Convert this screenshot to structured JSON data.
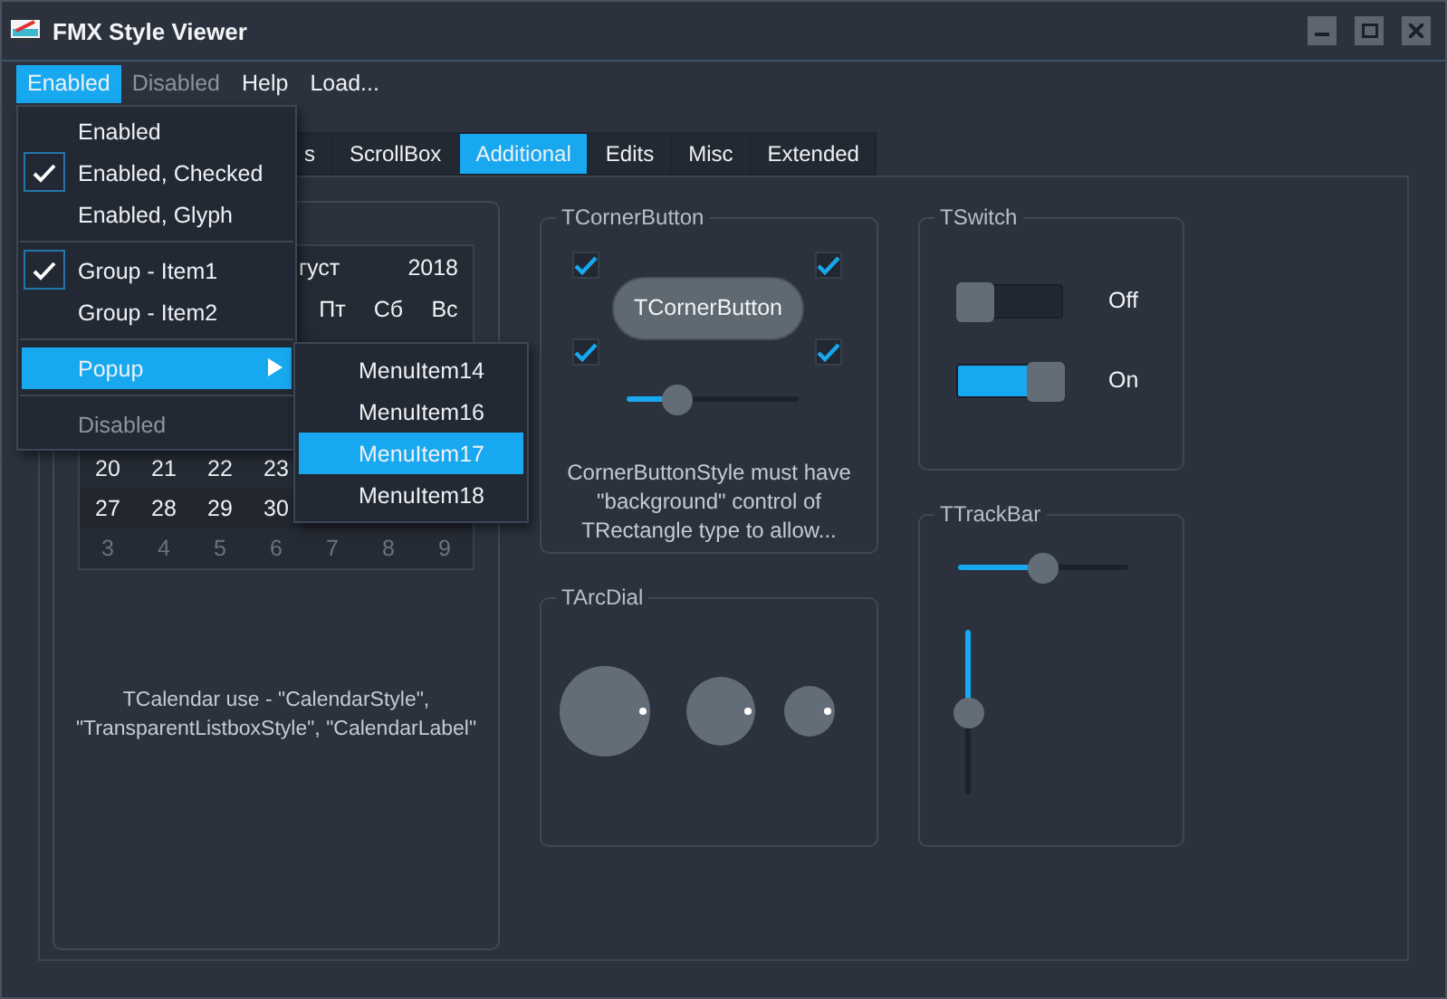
{
  "window": {
    "title": "FMX Style Viewer"
  },
  "menubar": [
    {
      "label": "Enabled",
      "selected": true,
      "disabled": false
    },
    {
      "label": "Disabled",
      "selected": false,
      "disabled": true
    },
    {
      "label": "Help",
      "selected": false,
      "disabled": false
    },
    {
      "label": "Load...",
      "selected": false,
      "disabled": false
    }
  ],
  "menu": {
    "items": [
      {
        "kind": "item",
        "label": "Enabled",
        "checked": false,
        "selected": false,
        "disabled": false
      },
      {
        "kind": "item",
        "label": "Enabled, Checked",
        "checked": true,
        "selected": false,
        "disabled": false
      },
      {
        "kind": "item",
        "label": "Enabled, Glyph",
        "checked": false,
        "selected": false,
        "disabled": false
      },
      {
        "kind": "separator"
      },
      {
        "kind": "item",
        "label": "Group - Item1",
        "checked": true,
        "selected": false,
        "disabled": false
      },
      {
        "kind": "item",
        "label": "Group - Item2",
        "checked": false,
        "selected": false,
        "disabled": false
      },
      {
        "kind": "separator"
      },
      {
        "kind": "submenu",
        "label": "Popup",
        "checked": false,
        "selected": true,
        "disabled": false
      },
      {
        "kind": "separator"
      },
      {
        "kind": "item",
        "label": "Disabled",
        "checked": false,
        "selected": false,
        "disabled": true
      }
    ]
  },
  "submenu": {
    "items": [
      {
        "label": "MenuItem14",
        "selected": false
      },
      {
        "label": "MenuItem16",
        "selected": false
      },
      {
        "label": "MenuItem17",
        "selected": true
      },
      {
        "label": "MenuItem18",
        "selected": false
      }
    ]
  },
  "tabs": [
    {
      "label": "s",
      "selected": false
    },
    {
      "label": "ScrollBox",
      "selected": false
    },
    {
      "label": "Additional",
      "selected": true
    },
    {
      "label": "Edits",
      "selected": false
    },
    {
      "label": "Misc",
      "selected": false
    },
    {
      "label": "Extended",
      "selected": false
    }
  ],
  "calendar": {
    "month": "густ",
    "year": "2018",
    "rows": [
      {
        "kind": "weekdays",
        "cells": [
          "",
          "",
          "",
          "",
          "Пт",
          "Сб",
          "Вс"
        ]
      },
      {
        "kind": "days",
        "cells": [
          "20",
          "21",
          "22",
          "23",
          "",
          "",
          ""
        ]
      },
      {
        "kind": "days",
        "cells": [
          "27",
          "28",
          "29",
          "30",
          "",
          "",
          ""
        ]
      },
      {
        "kind": "other",
        "cells": [
          "3",
          "4",
          "5",
          "6",
          "7",
          "8",
          "9"
        ]
      }
    ],
    "caption": "TCalendar use - \"CalendarStyle\", \"TransparentListboxStyle\", \"CalendarLabel\""
  },
  "corner_button": {
    "title": "TCornerButton",
    "button": "TCornerButton",
    "corners": [
      {
        "checked": true
      },
      {
        "checked": true
      },
      {
        "checked": true
      },
      {
        "checked": true
      }
    ],
    "slider": {
      "level": 0.25
    },
    "caption": "CornerButtonStyle must have \"background\" control of TRectangle type to allow..."
  },
  "switches": {
    "title": "TSwitch",
    "items": [
      {
        "label": "Off",
        "on": false
      },
      {
        "label": "On",
        "on": true
      }
    ]
  },
  "arc_dial": {
    "title": "TArcDial"
  },
  "trackbar": {
    "title": "TTrackBar",
    "horizontal": {
      "level": 0.5
    },
    "vertical": {
      "level": 0.5
    }
  }
}
